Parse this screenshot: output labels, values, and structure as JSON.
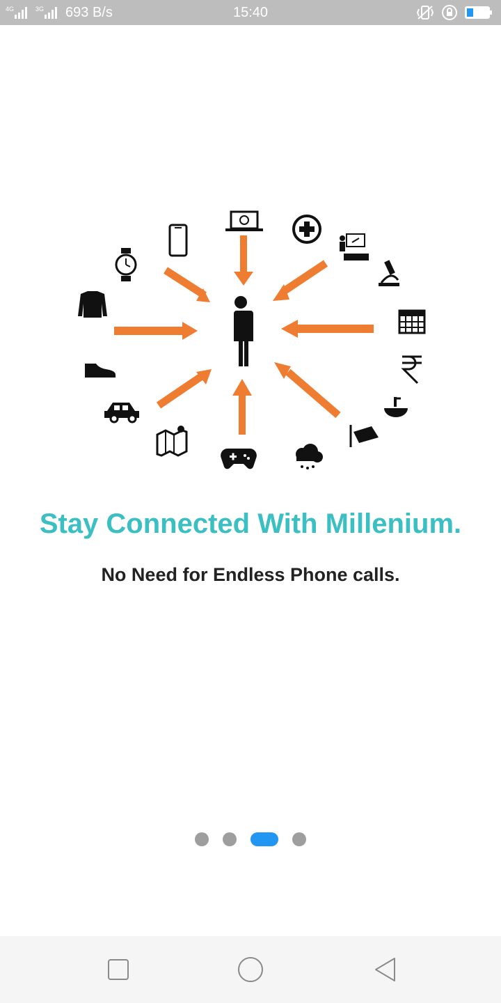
{
  "status_bar": {
    "network_label_1": "4G",
    "network_label_2": "3G",
    "speed": "693 B/s",
    "time": "15:40",
    "icons": [
      "signal-icon",
      "signal-icon",
      "vibrate-icon",
      "rotation-lock-icon",
      "battery-icon"
    ],
    "battery_level": 0.3
  },
  "onboarding": {
    "title": "Stay Connected With Millenium.",
    "subtitle": "No Need for Endless Phone calls.",
    "title_color": "#3bbfc3",
    "accent_color": "#ee7d32",
    "illustration_icons": [
      "watch-icon",
      "phone-icon",
      "laptop-icon",
      "medical-icon",
      "classroom-icon",
      "microscope-icon",
      "calendar-icon",
      "rupee-icon",
      "sink-icon",
      "cctv-icon",
      "rain-cloud-icon",
      "gamepad-icon",
      "map-icon",
      "car-icon",
      "shoe-icon",
      "shirt-icon",
      "person-icon"
    ]
  },
  "pager": {
    "page_count": 4,
    "active_index": 2,
    "active_color": "#2196f3"
  },
  "nav_bar": {
    "buttons": [
      "recent-apps-button",
      "home-button",
      "back-button"
    ]
  }
}
